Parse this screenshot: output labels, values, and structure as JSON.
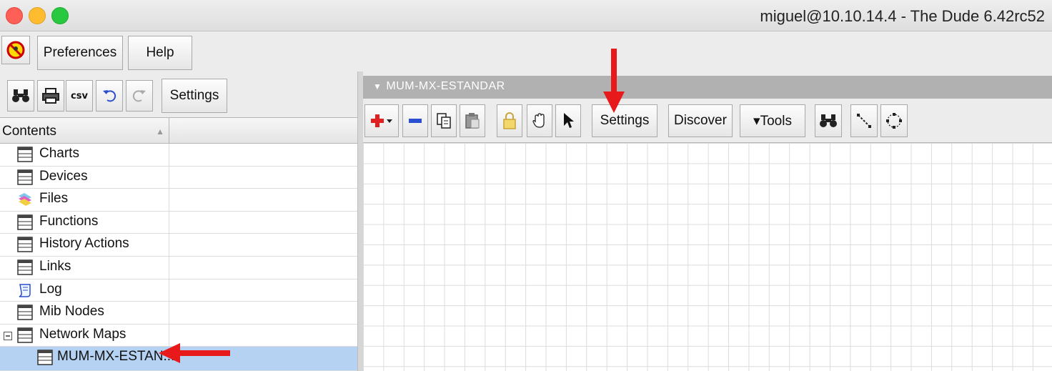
{
  "window": {
    "title": "miguel@10.10.14.4 - The Dude 6.42rc52"
  },
  "menu": {
    "preferences_label": "Preferences",
    "help_label": "Help"
  },
  "left_toolbar": {
    "settings_label": "Settings",
    "csv_label": "csv"
  },
  "contents": {
    "header": "Contents",
    "items": [
      {
        "label": "Charts",
        "icon": "table-icon"
      },
      {
        "label": "Devices",
        "icon": "table-icon"
      },
      {
        "label": "Files",
        "icon": "files-icon"
      },
      {
        "label": "Functions",
        "icon": "table-icon"
      },
      {
        "label": "History Actions",
        "icon": "table-icon"
      },
      {
        "label": "Links",
        "icon": "table-icon"
      },
      {
        "label": "Log",
        "icon": "log-icon"
      },
      {
        "label": "Mib Nodes",
        "icon": "table-icon"
      },
      {
        "label": "Network Maps",
        "icon": "table-icon",
        "expanded": true
      },
      {
        "label": "MUM-MX-ESTAN...",
        "icon": "table-icon",
        "selected": true
      }
    ]
  },
  "map": {
    "title": "MUM-MX-ESTANDAR",
    "settings_label": "Settings",
    "discover_label": "Discover",
    "tools_label": "▾Tools"
  },
  "colors": {
    "selection": "#b5d2f3",
    "annotation_arrow": "#e8191b",
    "add": "#e02020",
    "remove": "#2a4fd0"
  }
}
